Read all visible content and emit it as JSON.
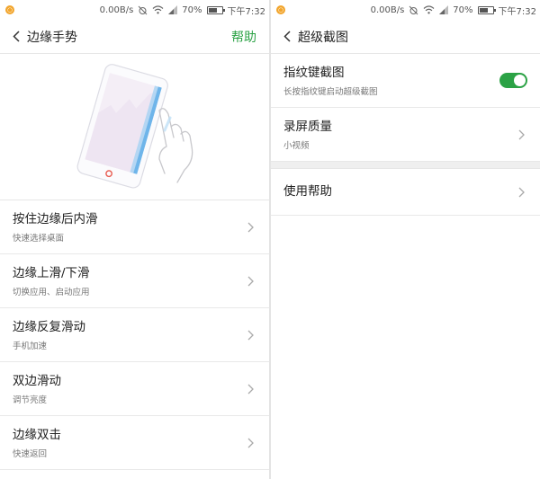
{
  "colors": {
    "accent": "#2ba245",
    "toggle_on": "#2ba245",
    "notification_icon": "#f2a52c"
  },
  "left_screen": {
    "status_bar": {
      "notification_icon": "notification-icon",
      "network_speed": "0.00B/s",
      "battery_percent": "70%",
      "time": "下午7:32"
    },
    "nav": {
      "back_icon": "chevron-left-icon",
      "title": "边缘手势",
      "action_label": "帮助"
    },
    "illustration_icon": "phone-edge-gesture-illustration",
    "items": [
      {
        "title": "按住边缘后内滑",
        "subtitle": "快速选择桌面"
      },
      {
        "title": "边缘上滑/下滑",
        "subtitle": "切换应用、启动应用"
      },
      {
        "title": "边缘反复滑动",
        "subtitle": "手机加速"
      },
      {
        "title": "双边滑动",
        "subtitle": "调节亮度"
      },
      {
        "title": "边缘双击",
        "subtitle": "快速返回"
      }
    ]
  },
  "right_screen": {
    "status_bar": {
      "notification_icon": "notification-icon",
      "network_speed": "0.00B/s",
      "battery_percent": "70%",
      "time": "下午7:32"
    },
    "nav": {
      "back_icon": "chevron-left-icon",
      "title": "超级截图"
    },
    "items": [
      {
        "title": "指纹键截图",
        "subtitle": "长按指纹键启动超级截图",
        "toggle": true
      },
      {
        "title": "录屏质量",
        "subtitle": "小视频"
      },
      {
        "title": "使用帮助"
      }
    ]
  }
}
